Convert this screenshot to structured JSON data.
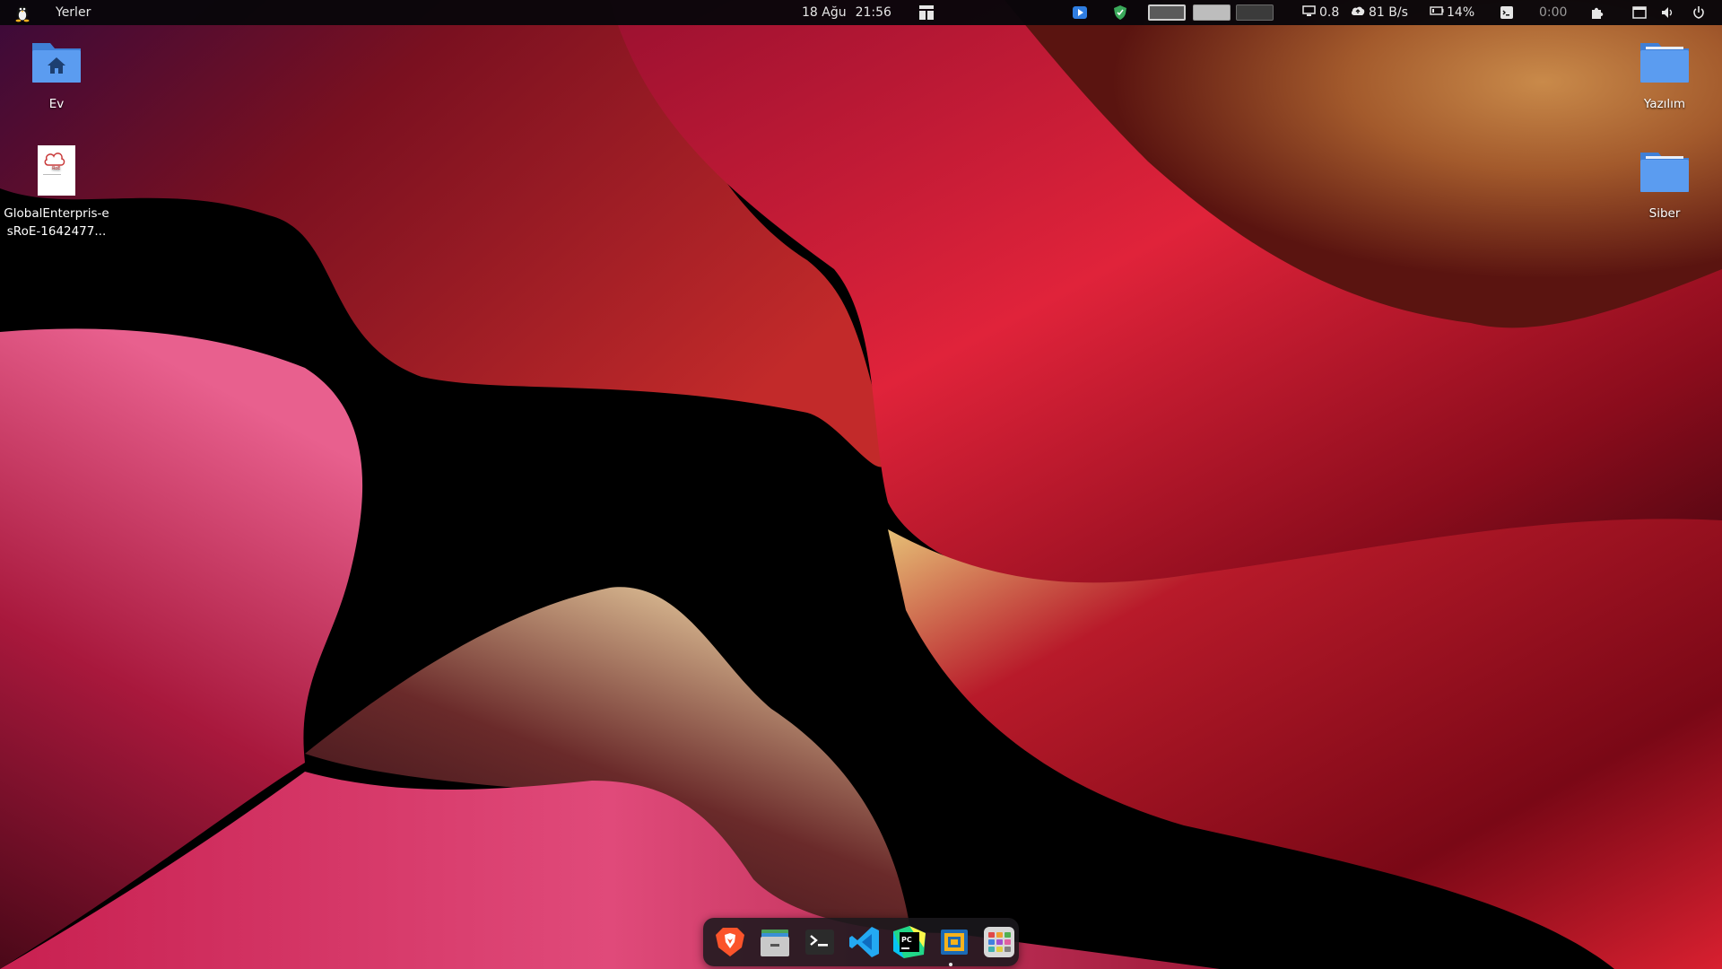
{
  "top_panel": {
    "menu_label": "Yerler",
    "date": "18 Ağu",
    "time": "21:56",
    "load": "0.8",
    "net_speed": "81 B/s",
    "battery": "14%",
    "timer": "0:00"
  },
  "desktop": {
    "left_icons": [
      {
        "label": "Ev",
        "icon": "home-folder-icon"
      },
      {
        "label": "GlobalEnterpris-esRoE-1642477...",
        "icon": "document-thumbnail-icon"
      }
    ],
    "right_icons": [
      {
        "label": "Yazılım",
        "icon": "folder-icon"
      },
      {
        "label": "Siber",
        "icon": "folder-icon"
      }
    ]
  },
  "dock": {
    "apps": [
      {
        "name": "brave-browser-icon"
      },
      {
        "name": "file-manager-icon"
      },
      {
        "name": "terminal-icon"
      },
      {
        "name": "vscode-icon"
      },
      {
        "name": "pycharm-icon"
      },
      {
        "name": "virtualbox-icon"
      },
      {
        "name": "app-grid-icon"
      }
    ]
  },
  "colors": {
    "panel_bg": "#08060a",
    "folder_blue": "#5b9cf0",
    "dock_bg": "#1a181c"
  }
}
